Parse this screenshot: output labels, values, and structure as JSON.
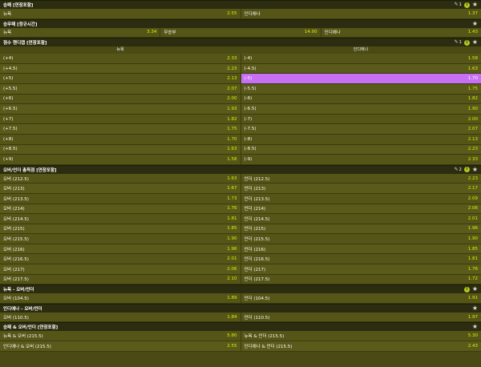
{
  "sections": {
    "winner": {
      "title": "승패 [연장포함]",
      "count": "1",
      "row": {
        "home": "뉴욕",
        "home_odd": "2.55",
        "away": "인디애나",
        "away_odd": "1.37"
      }
    },
    "winner3": {
      "title": "승무패 [정규시간]",
      "row": {
        "home": "뉴욕",
        "home_odd": "3.34",
        "draw": "무승부",
        "draw_odd": "14.00",
        "away": "인디애나",
        "away_odd": "1.43"
      }
    },
    "handicap": {
      "title": "점수 핸디캡 [연장포함]",
      "count": "1",
      "col_home": "뉴욕",
      "col_away": "인디애나",
      "rows": [
        {
          "home": "(+4)",
          "home_odd": "2.33",
          "away": "(-4)",
          "away_odd": "1.58"
        },
        {
          "home": "(+4.5)",
          "home_odd": "2.23",
          "away": "(-4.5)",
          "away_odd": "1.63"
        },
        {
          "home": "(+5)",
          "home_odd": "2.13",
          "away": "(-5)",
          "away_odd": "1.70"
        },
        {
          "home": "(+5.5)",
          "home_odd": "2.07",
          "away": "(-5.5)",
          "away_odd": "1.75"
        },
        {
          "home": "(+6)",
          "home_odd": "2.00",
          "away": "(-6)",
          "away_odd": "1.82"
        },
        {
          "home": "(+6.5)",
          "home_odd": "1.93",
          "away": "(-6.5)",
          "away_odd": "1.90"
        },
        {
          "home": "(+7)",
          "home_odd": "1.82",
          "away": "(-7)",
          "away_odd": "2.00"
        },
        {
          "home": "(+7.5)",
          "home_odd": "1.75",
          "away": "(-7.5)",
          "away_odd": "2.07"
        },
        {
          "home": "(+8)",
          "home_odd": "1.70",
          "away": "(-8)",
          "away_odd": "2.13"
        },
        {
          "home": "(+8.5)",
          "home_odd": "1.63",
          "away": "(-8.5)",
          "away_odd": "2.23"
        },
        {
          "home": "(+9)",
          "home_odd": "1.58",
          "away": "(-9)",
          "away_odd": "2.33"
        }
      ]
    },
    "overunder": {
      "title": "오버/언더 총득점 [연장포함]",
      "count": "2",
      "rows": [
        {
          "home": "오버 (212.5)",
          "home_odd": "1.63",
          "away": "언더 (212.5)",
          "away_odd": "2.23"
        },
        {
          "home": "오버 (213)",
          "home_odd": "1.67",
          "away": "언더 (213)",
          "away_odd": "2.17"
        },
        {
          "home": "오버 (213.5)",
          "home_odd": "1.73",
          "away": "언더 (213.5)",
          "away_odd": "2.09"
        },
        {
          "home": "오버 (214)",
          "home_odd": "1.76",
          "away": "언더 (214)",
          "away_odd": "2.06"
        },
        {
          "home": "오버 (214.5)",
          "home_odd": "1.81",
          "away": "언더 (214.5)",
          "away_odd": "2.01"
        },
        {
          "home": "오버 (215)",
          "home_odd": "1.85",
          "away": "언더 (215)",
          "away_odd": "1.96"
        },
        {
          "home": "오버 (215.5)",
          "home_odd": "1.90",
          "away": "언더 (215.5)",
          "away_odd": "1.90"
        },
        {
          "home": "오버 (216)",
          "home_odd": "1.96",
          "away": "언더 (216)",
          "away_odd": "1.85"
        },
        {
          "home": "오버 (216.5)",
          "home_odd": "2.01",
          "away": "언더 (216.5)",
          "away_odd": "1.81"
        },
        {
          "home": "오버 (217)",
          "home_odd": "2.06",
          "away": "언더 (217)",
          "away_odd": "1.76"
        },
        {
          "home": "오버 (217.5)",
          "home_odd": "2.10",
          "away": "언더 (217.5)",
          "away_odd": "1.72"
        }
      ]
    },
    "team1_ou": {
      "title": "뉴욕 - 오버/언더",
      "row": {
        "home": "오버 (104.5)",
        "home_odd": "1.89",
        "away": "언더 (104.5)",
        "away_odd": "1.91"
      }
    },
    "team2_ou": {
      "title": "인디애나 - 오버/언더",
      "row": {
        "home": "오버 (110.5)",
        "home_odd": "1.84",
        "away": "언더 (110.5)",
        "away_odd": "1.97"
      }
    },
    "combo": {
      "title": "승패 & 오버/언더 [연장포함]",
      "rows": [
        {
          "home": "뉴욕 & 오버 (215.5)",
          "home_odd": "5.80",
          "away": "뉴욕 & 언더 (215.5)",
          "away_odd": "5.30"
        },
        {
          "home": "인디애나 & 오버 (215.5)",
          "home_odd": "2.55",
          "away": "인디애나 & 언더 (215.5)",
          "away_odd": "2.43"
        }
      ]
    }
  },
  "icons": {
    "info": "i",
    "star": "★",
    "pin": "✎"
  },
  "colors": {
    "odd": "#ddf000",
    "highlight": "#c770f5",
    "header_bg": "#2c2c10",
    "row_bg": "#555517"
  }
}
